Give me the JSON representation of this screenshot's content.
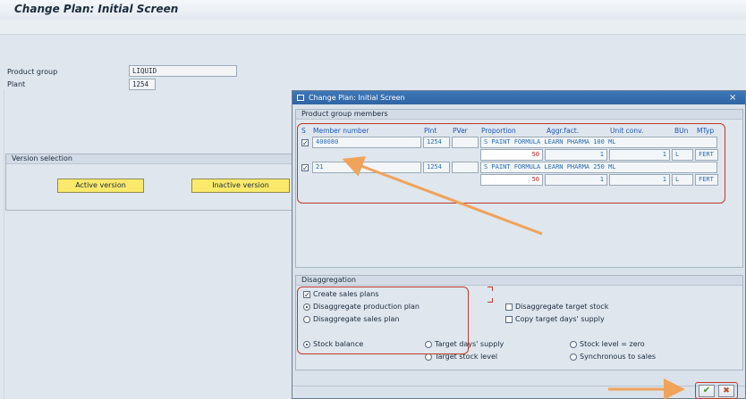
{
  "main": {
    "title": "Change Plan: Initial Screen",
    "product_group_label": "Product group",
    "product_group_value": "LIQUID",
    "plant_label": "Plant",
    "plant_value": "1254",
    "version_selection_title": "Version selection",
    "active_version_label": "Active version",
    "inactive_version_label": "Inactive version"
  },
  "dialog": {
    "title": "Change Plan: Initial Screen",
    "close_glyph": "×",
    "members_section": "Product group members",
    "columns": {
      "s": "S",
      "member": "Member number",
      "plnt": "Plnt",
      "pver": "PVer",
      "proportion": "Proportion",
      "aggr": "Aggr.fact.",
      "unit_conv": "Unit conv.",
      "bun": "BUn",
      "mtyp": "MTyp"
    },
    "members": [
      {
        "checked": true,
        "number": "400080",
        "plant": "1254",
        "pver": "",
        "description": "S PAINT FORMULA LEARN PHARMA 100 ML",
        "proportion": "50",
        "aggr": "1",
        "unit_conv": "1",
        "bun": "L",
        "mtyp": "FERT"
      },
      {
        "checked": true,
        "number": "21",
        "plant": "1254",
        "pver": "",
        "description": "S PAINT FORMULA LEARN PHARMA 250 ML",
        "proportion": "50",
        "aggr": "1",
        "unit_conv": "1",
        "bun": "L",
        "mtyp": "FERT"
      }
    ],
    "disaggregation_section": "Disaggregation",
    "options": {
      "create_sales_plans": "Create sales plans",
      "disagg_production_plan": "Disaggregate production plan",
      "disagg_sales_plan": "Disaggregate sales plan",
      "disagg_target_stock": "Disaggregate target stock",
      "copy_target_days_supply": "Copy target days' supply",
      "stock_balance": "Stock balance",
      "target_days_supply": "Target days' supply",
      "target_stock_level": "Target stock level",
      "stock_level_zero": "Stock level = zero",
      "synchronous_to_sales": "Synchronous to sales"
    },
    "confirm_glyph": "✔",
    "cancel_glyph": "✖"
  },
  "colors": {
    "accent_red": "#c0392b",
    "arrow_orange": "#f0a35a",
    "dialog_title_blue": "#3466a8",
    "button_yellow": "#fbe96b"
  }
}
